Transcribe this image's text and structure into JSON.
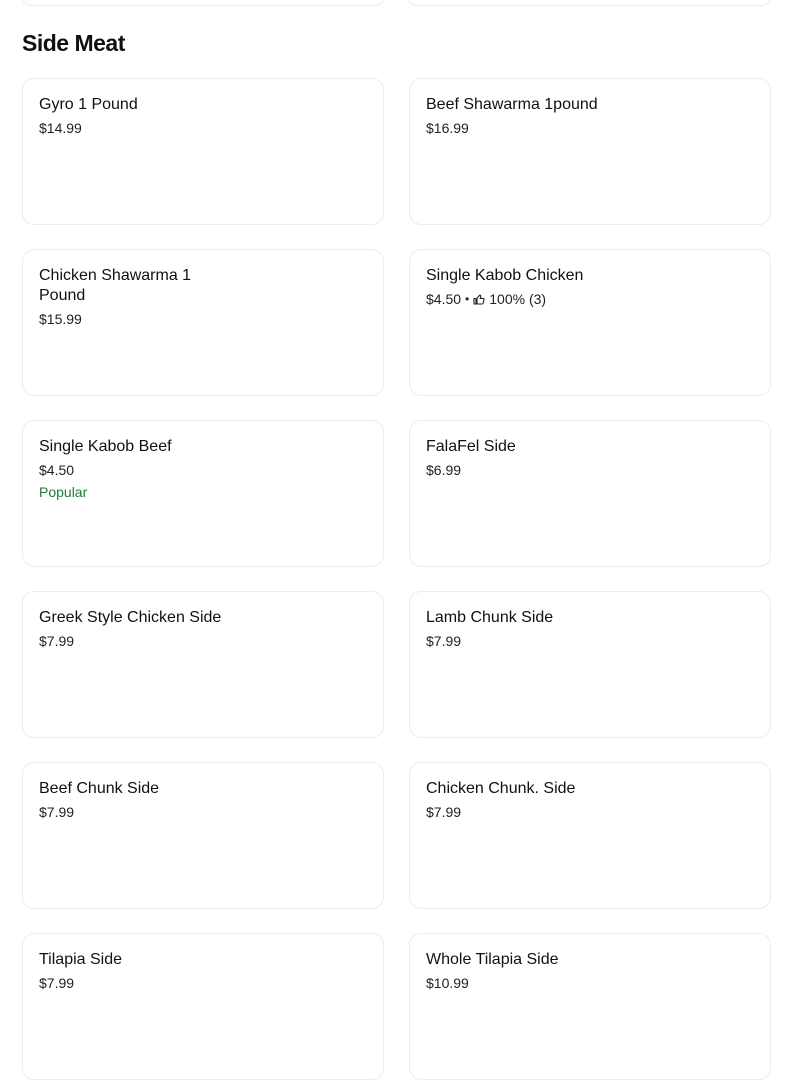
{
  "section": {
    "title": "Side Meat"
  },
  "items": [
    {
      "name": "Gyro 1 Pound",
      "price": "$14.99"
    },
    {
      "name": "Beef Shawarma 1pound",
      "price": "$16.99"
    },
    {
      "name": "Chicken Shawarma 1 Pound",
      "price": "$15.99"
    },
    {
      "name": "Single Kabob Chicken",
      "price": "$4.50",
      "separator": "•",
      "rating_icon": "thumbs-up-icon",
      "rating": "100% (3)"
    },
    {
      "name": "Single Kabob Beef",
      "price": "$4.50",
      "badge": "Popular",
      "badge_color": "#1e7c3a"
    },
    {
      "name": "FalaFel Side",
      "price": "$6.99"
    },
    {
      "name": "Greek Style Chicken Side",
      "price": "$7.99"
    },
    {
      "name": "Lamb Chunk Side",
      "price": "$7.99"
    },
    {
      "name": "Beef Chunk Side",
      "price": "$7.99"
    },
    {
      "name": "Chicken Chunk. Side",
      "price": "$7.99"
    },
    {
      "name": "Tilapia Side",
      "price": "$7.99"
    },
    {
      "name": "Whole Tilapia Side",
      "price": "$10.99"
    }
  ]
}
